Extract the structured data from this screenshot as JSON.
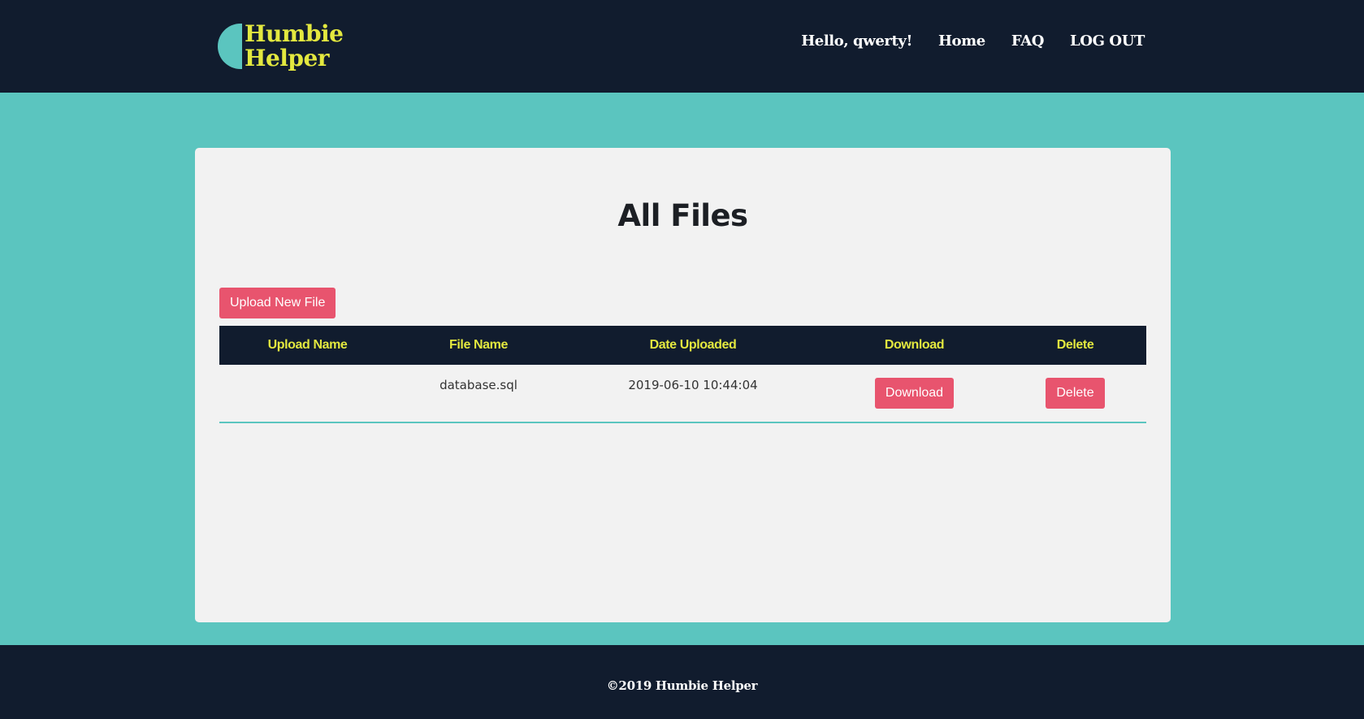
{
  "colors": {
    "background": "#5bc5bf",
    "header_bg": "#111c2e",
    "accent_yellow": "#e3e83f",
    "button_red": "#e8546e",
    "card_bg": "#f2f2f2"
  },
  "header": {
    "logo": {
      "line1": "Humbie",
      "line2": "Helper",
      "mark_icon": "half-circle-logo-icon"
    },
    "nav": {
      "greeting": "Hello, qwerty!",
      "home": "Home",
      "faq": "FAQ",
      "logout": "LOG OUT"
    }
  },
  "main": {
    "title": "All Files",
    "upload_button": "Upload New File",
    "table": {
      "columns": [
        "Upload Name",
        "File Name",
        "Date Uploaded",
        "Download",
        "Delete"
      ],
      "rows": [
        {
          "upload_name": "",
          "file_name": "database.sql",
          "date_uploaded": "2019-06-10 10:44:04",
          "download_label": "Download",
          "delete_label": "Delete"
        }
      ]
    }
  },
  "footer": {
    "text": "©2019 Humbie Helper"
  }
}
